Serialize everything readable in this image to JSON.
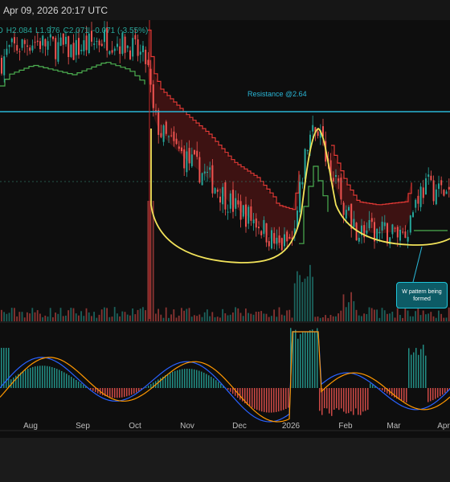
{
  "header": {
    "timestamp": "Apr 09, 2026 20:17 UTC",
    "ohlc": {
      "open_partial": "O",
      "high": "H2.084",
      "low": "L1.976",
      "close": "C2.071",
      "change": "-0.071 (-3.55%)"
    }
  },
  "colors": {
    "background": "#0e0e0e",
    "bull": "#26a69a",
    "bear": "#ef5350",
    "resistance": "#29b6d6",
    "pattern": "#f2e35a",
    "supertrend_up": "#4caf50",
    "supertrend_down": "#b71c1c",
    "macd": "#2962ff",
    "signal": "#ff9800"
  },
  "annotations": {
    "resistance_label": "Resistance @2.64",
    "pattern_callout": "W pattern\nbeing formed"
  },
  "chart_data": {
    "type": "candlestick",
    "timeframe": "daily",
    "x_axis_labels": [
      "Aug",
      "Sep",
      "Oct",
      "Nov",
      "Dec",
      "2026",
      "Feb",
      "Mar",
      "Apr"
    ],
    "price_range_visible": [
      1.45,
      3.2
    ],
    "resistance_level": 2.64,
    "key_points": [
      {
        "x": "Jul",
        "price": 3.05
      },
      {
        "x": "early Oct",
        "price": 3.1
      },
      {
        "x": "mid Oct",
        "price": 2.5
      },
      {
        "x": "Nov",
        "price": 2.3
      },
      {
        "x": "Dec",
        "price": 2.0
      },
      {
        "x": "late Dec",
        "price": 1.78
      },
      {
        "x": "mid Jan",
        "price": 2.62
      },
      {
        "x": "Feb",
        "price": 2.0
      },
      {
        "x": "early Mar",
        "price": 1.85
      },
      {
        "x": "mid Mar",
        "price": 2.15
      },
      {
        "x": "Apr",
        "price": 2.07
      }
    ],
    "last": {
      "open": "",
      "high": 2.084,
      "low": 1.976,
      "close": 2.071,
      "change": -0.071,
      "change_pct": -3.55
    },
    "indicators": [
      "volume",
      "supertrend",
      "MACD histogram",
      "MACD line",
      "signal line"
    ],
    "grid": false,
    "legend": "none"
  }
}
